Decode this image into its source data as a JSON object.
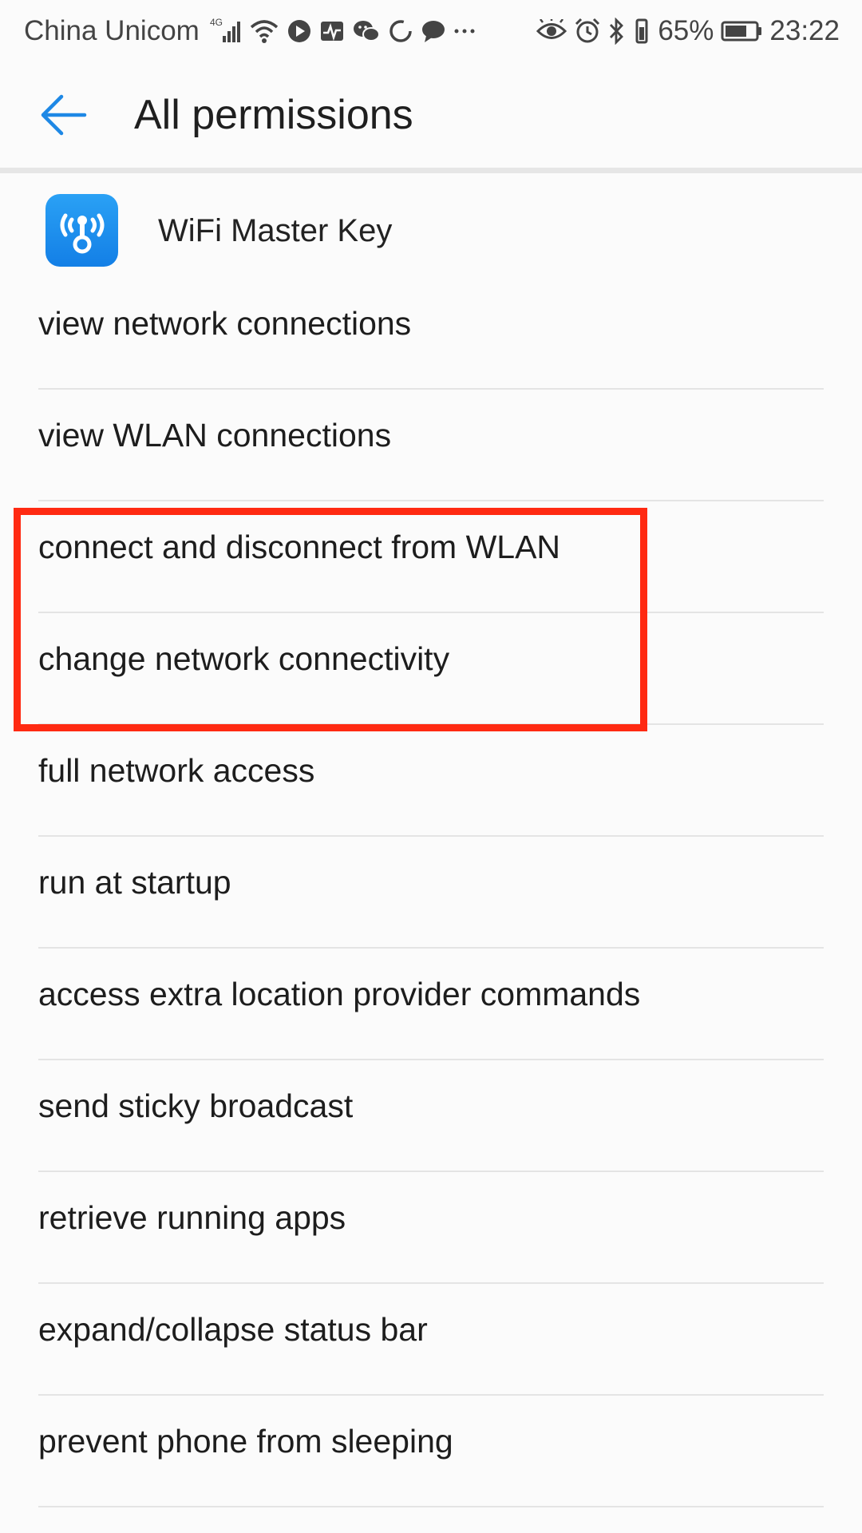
{
  "status_bar": {
    "carrier": "China Unicom",
    "network": "4G",
    "battery_percent": "65%",
    "time": "23:22",
    "icons": [
      "signal-icon",
      "wifi-icon",
      "play-icon",
      "activity-icon",
      "wechat-icon",
      "loading-icon",
      "chat-icon",
      "more-icon",
      "eye-icon",
      "alarm-icon",
      "bluetooth-icon",
      "vibrate-icon",
      "battery-icon"
    ]
  },
  "header": {
    "title": "All permissions",
    "back_icon": "back-arrow-icon"
  },
  "app": {
    "name": "WiFi Master Key",
    "icon": "wifi-key-icon"
  },
  "permissions": [
    {
      "label": "view network connections"
    },
    {
      "label": "view WLAN connections"
    },
    {
      "label": "connect and disconnect from WLAN"
    },
    {
      "label": "change network connectivity"
    },
    {
      "label": "full network access"
    },
    {
      "label": "run at startup"
    },
    {
      "label": "access extra location provider commands"
    },
    {
      "label": "send sticky broadcast"
    },
    {
      "label": "retrieve running apps"
    },
    {
      "label": "expand/collapse status bar"
    },
    {
      "label": "prevent phone from sleeping"
    }
  ],
  "annotation": {
    "color": "#ff2a12",
    "highlighted_items": [
      "connect and disconnect from WLAN",
      "change network connectivity"
    ]
  },
  "colors": {
    "accent": "#1e88e5",
    "background": "#fbfbfb",
    "divider": "#e4e4e4"
  }
}
